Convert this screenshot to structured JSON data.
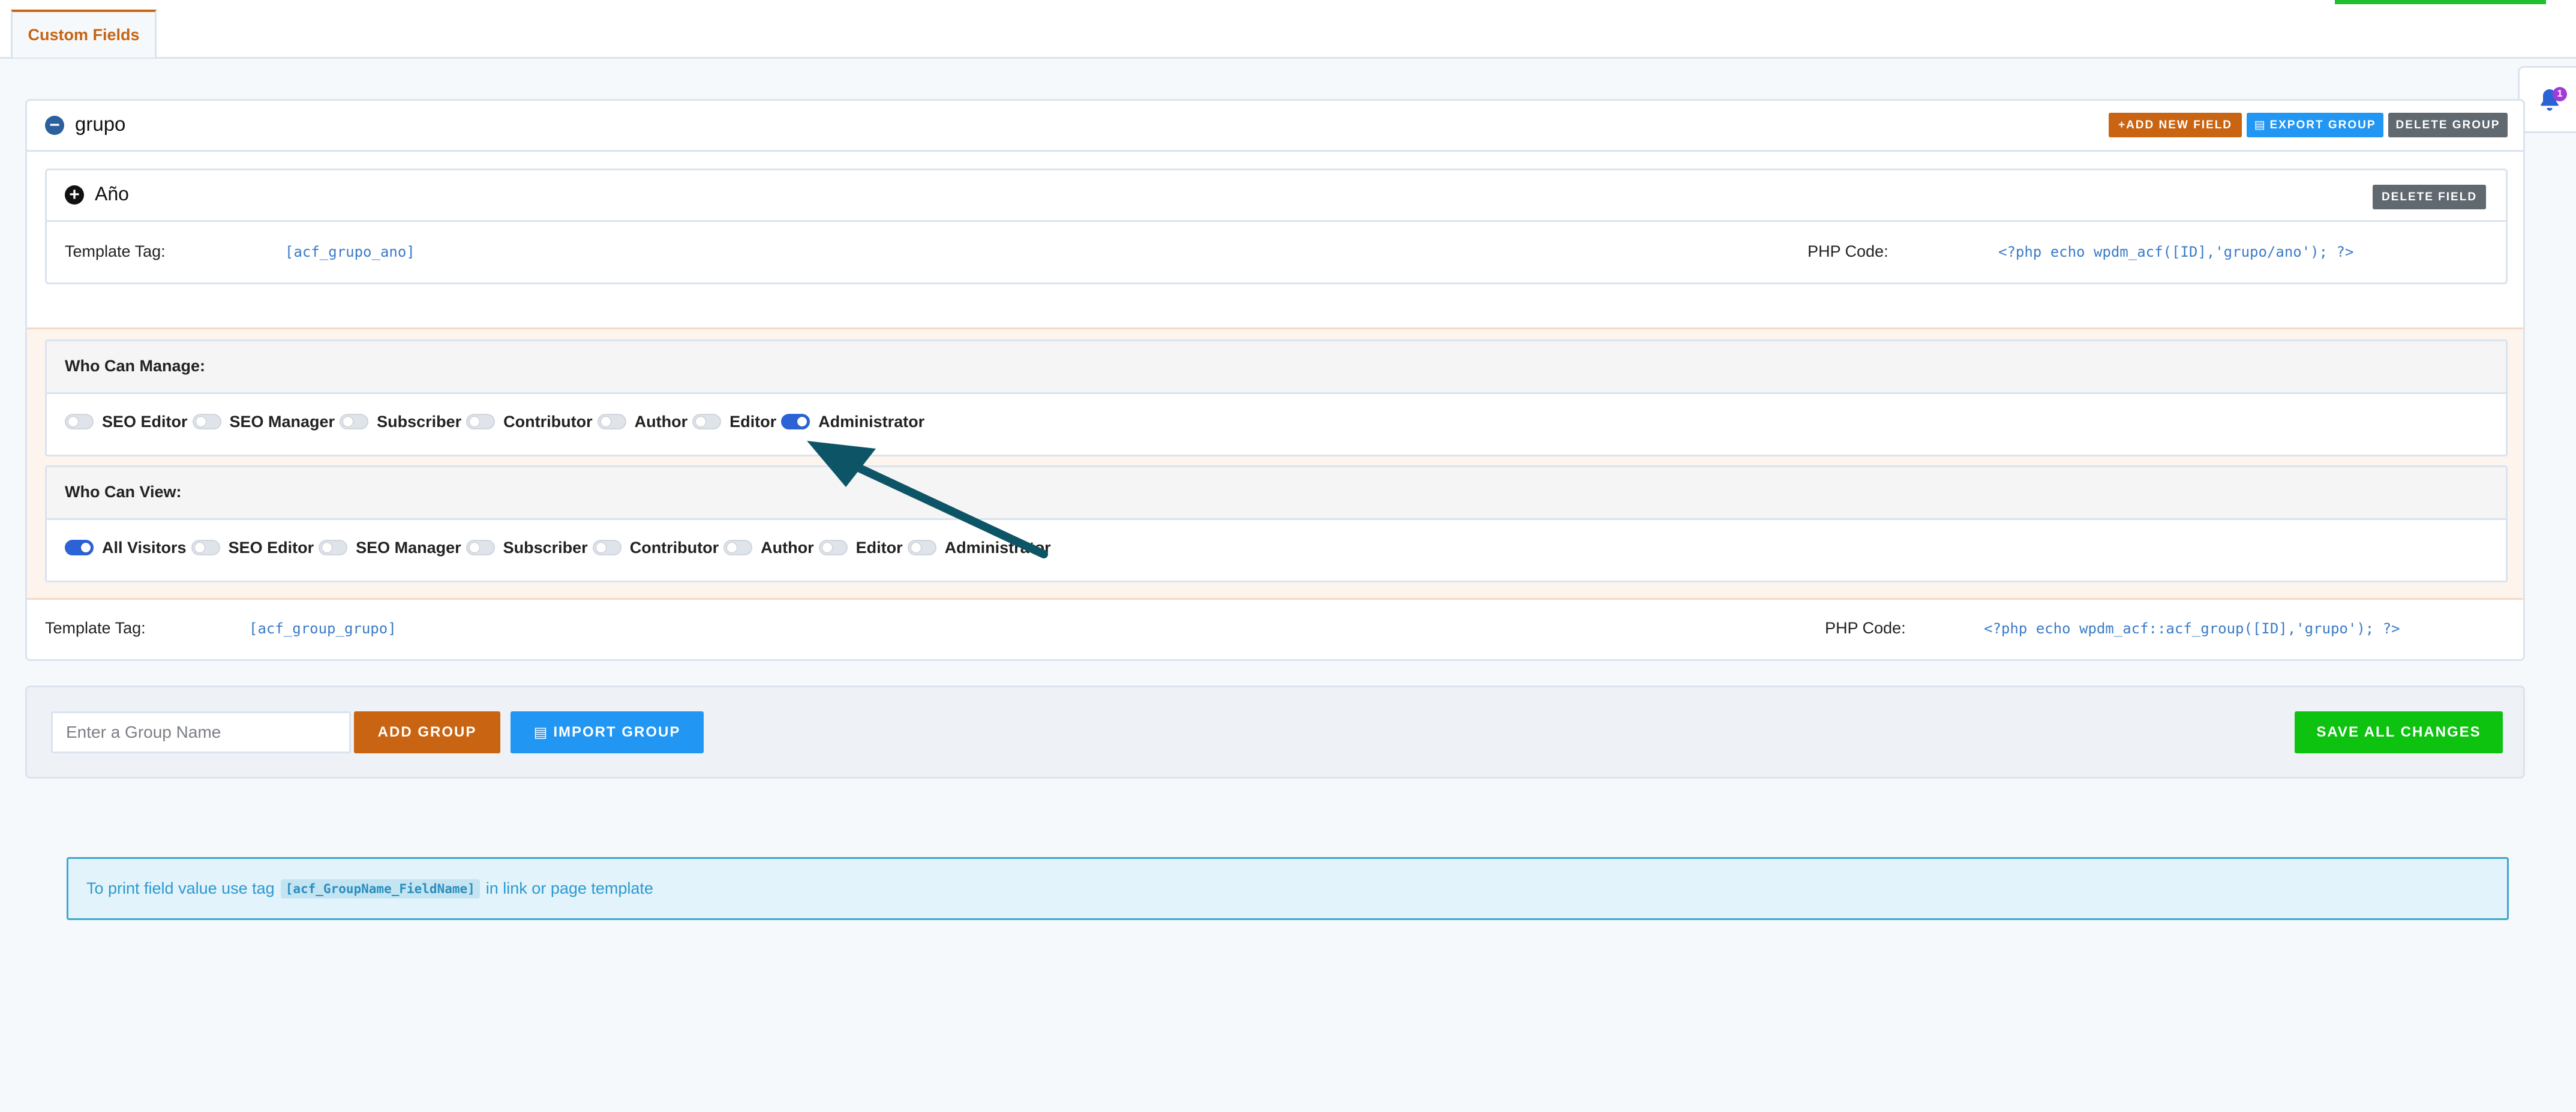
{
  "tabs": [
    {
      "label": "Custom Fields",
      "active": true
    }
  ],
  "notifications": {
    "count": "1"
  },
  "group": {
    "name": "grupo",
    "buttons": {
      "add_field": "+ADD NEW FIELD",
      "export_group": "EXPORT GROUP",
      "delete_group": "DELETE GROUP"
    },
    "field": {
      "name": "Año",
      "delete_label": "DELETE FIELD",
      "template_tag_label": "Template Tag:",
      "template_tag": "[acf_grupo_ano]",
      "php_label": "PHP Code:",
      "php_code": "<?php echo wpdm_acf([ID],'grupo/ano'); ?>"
    },
    "manage": {
      "title": "Who Can Manage:",
      "roles": [
        {
          "label": "SEO Editor",
          "on": false
        },
        {
          "label": "SEO Manager",
          "on": false
        },
        {
          "label": "Subscriber",
          "on": false
        },
        {
          "label": "Contributor",
          "on": false
        },
        {
          "label": "Author",
          "on": false
        },
        {
          "label": "Editor",
          "on": false
        },
        {
          "label": "Administrator",
          "on": true
        }
      ]
    },
    "view": {
      "title": "Who Can View:",
      "roles": [
        {
          "label": "All Visitors",
          "on": true
        },
        {
          "label": "SEO Editor",
          "on": false
        },
        {
          "label": "SEO Manager",
          "on": false
        },
        {
          "label": "Subscriber",
          "on": false
        },
        {
          "label": "Contributor",
          "on": false
        },
        {
          "label": "Author",
          "on": false
        },
        {
          "label": "Editor",
          "on": false
        },
        {
          "label": "Administrator",
          "on": false
        }
      ]
    },
    "footer": {
      "template_tag_label": "Template Tag:",
      "template_tag": "[acf_group_grupo]",
      "php_label": "PHP Code:",
      "php_code": "<?php echo wpdm_acf::acf_group([ID],'grupo'); ?>"
    }
  },
  "add_bar": {
    "input_placeholder": "Enter a Group Name",
    "input_value": "",
    "add_group": "ADD GROUP",
    "import_group": "IMPORT GROUP",
    "save_all": "SAVE ALL CHANGES"
  },
  "info": {
    "prefix": "To print field value use tag",
    "code": "[acf_GroupName_FieldName]",
    "suffix": "in link or page template"
  },
  "colors": {
    "accent_orange": "#c86412",
    "accent_blue": "#2196f3",
    "save_green": "#0ec210",
    "arrow": "#0d5566"
  }
}
